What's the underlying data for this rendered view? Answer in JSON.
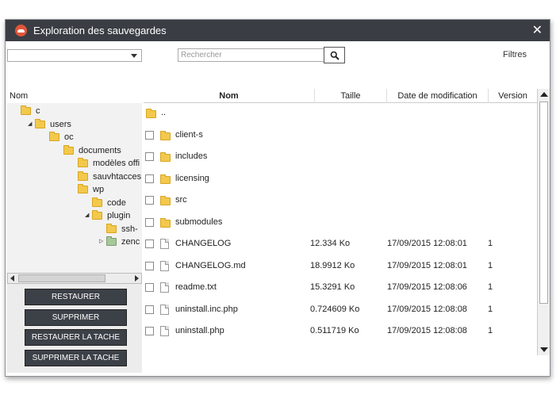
{
  "window": {
    "title": "Exploration des sauvegardes",
    "close": "✕"
  },
  "toolbar": {
    "select_value": "",
    "search_placeholder": "Rechercher",
    "filters_label": "Filtres"
  },
  "tree": {
    "header": "Nom",
    "items": [
      {
        "label": "c",
        "depth": 0,
        "expander": ""
      },
      {
        "label": "users",
        "depth": 1,
        "expander": "◢"
      },
      {
        "label": "oc",
        "depth": 2,
        "expander": ""
      },
      {
        "label": "documents",
        "depth": 3,
        "expander": ""
      },
      {
        "label": "modèles offi",
        "depth": 4,
        "expander": ""
      },
      {
        "label": "sauvhtacces",
        "depth": 4,
        "expander": ""
      },
      {
        "label": "wp",
        "depth": 4,
        "expander": ""
      },
      {
        "label": "code",
        "depth": 5,
        "expander": ""
      },
      {
        "label": "plugin",
        "depth": 5,
        "expander": "◢"
      },
      {
        "label": "ssh-",
        "depth": 6,
        "expander": ""
      },
      {
        "label": "zenc",
        "depth": 6,
        "expander": "▷"
      }
    ]
  },
  "actions": {
    "restore": "RESTAURER",
    "delete": "SUPPRIMER",
    "restore_task": "RESTAURER LA TACHE",
    "delete_task": "SUPPRIMER LA TACHE"
  },
  "list": {
    "columns": {
      "name": "Nom",
      "size": "Taille",
      "date": "Date de modification",
      "version": "Version"
    },
    "rows": [
      {
        "type": "folder",
        "name": "..",
        "size": "",
        "date": "",
        "version": "",
        "checkbox": false
      },
      {
        "type": "folder",
        "name": "client-s",
        "size": "",
        "date": "",
        "version": "",
        "checkbox": true
      },
      {
        "type": "folder",
        "name": "includes",
        "size": "",
        "date": "",
        "version": "",
        "checkbox": true
      },
      {
        "type": "folder",
        "name": "licensing",
        "size": "",
        "date": "",
        "version": "",
        "checkbox": true
      },
      {
        "type": "folder",
        "name": "src",
        "size": "",
        "date": "",
        "version": "",
        "checkbox": true
      },
      {
        "type": "folder",
        "name": "submodules",
        "size": "",
        "date": "",
        "version": "",
        "checkbox": true
      },
      {
        "type": "file",
        "name": "CHANGELOG",
        "size": "12.334 Ko",
        "date": "17/09/2015 12:08:01",
        "version": "1",
        "checkbox": true
      },
      {
        "type": "file",
        "name": "CHANGELOG.md",
        "size": "18.9912 Ko",
        "date": "17/09/2015 12:08:01",
        "version": "1",
        "checkbox": true
      },
      {
        "type": "file",
        "name": "readme.txt",
        "size": "15.3291 Ko",
        "date": "17/09/2015 12:08:06",
        "version": "1",
        "checkbox": true
      },
      {
        "type": "file",
        "name": "uninstall.inc.php",
        "size": "0.724609 Ko",
        "date": "17/09/2015 12:08:08",
        "version": "1",
        "checkbox": true
      },
      {
        "type": "file",
        "name": "uninstall.php",
        "size": "0.511719 Ko",
        "date": "17/09/2015 12:08:08",
        "version": "1",
        "checkbox": true
      }
    ]
  },
  "colors": {
    "titlebar": "#3a3e44",
    "button": "#3c4047",
    "folder": "#f2c94c",
    "app_icon": "#e0553a"
  }
}
